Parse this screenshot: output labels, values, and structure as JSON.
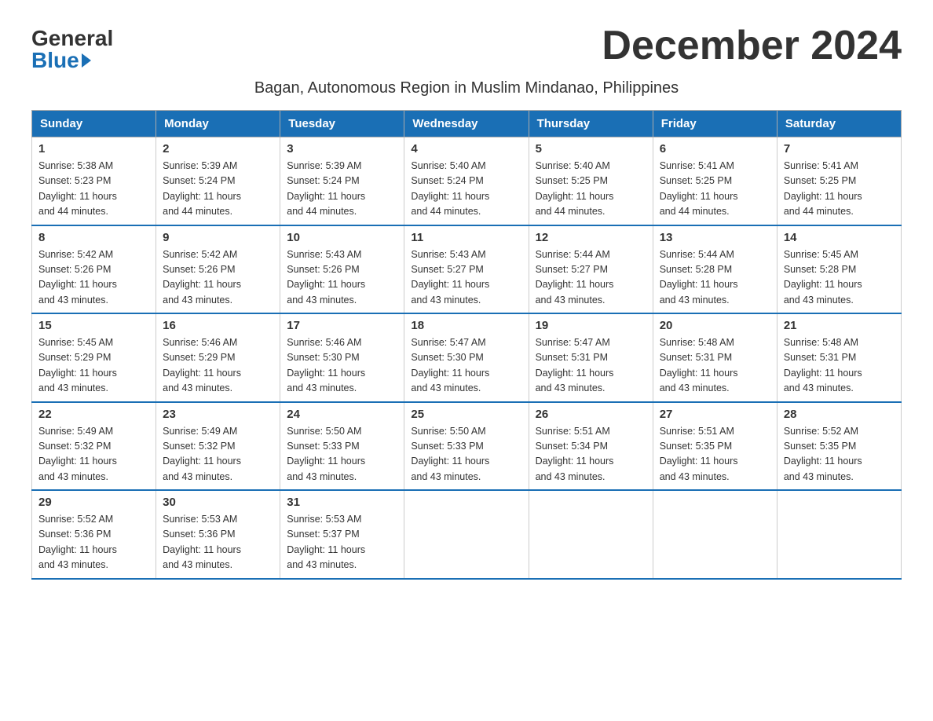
{
  "logo": {
    "general": "General",
    "blue": "Blue"
  },
  "title": "December 2024",
  "subtitle": "Bagan, Autonomous Region in Muslim Mindanao, Philippines",
  "days_of_week": [
    "Sunday",
    "Monday",
    "Tuesday",
    "Wednesday",
    "Thursday",
    "Friday",
    "Saturday"
  ],
  "weeks": [
    [
      {
        "day": "1",
        "sunrise": "5:38 AM",
        "sunset": "5:23 PM",
        "daylight": "11 hours and 44 minutes."
      },
      {
        "day": "2",
        "sunrise": "5:39 AM",
        "sunset": "5:24 PM",
        "daylight": "11 hours and 44 minutes."
      },
      {
        "day": "3",
        "sunrise": "5:39 AM",
        "sunset": "5:24 PM",
        "daylight": "11 hours and 44 minutes."
      },
      {
        "day": "4",
        "sunrise": "5:40 AM",
        "sunset": "5:24 PM",
        "daylight": "11 hours and 44 minutes."
      },
      {
        "day": "5",
        "sunrise": "5:40 AM",
        "sunset": "5:25 PM",
        "daylight": "11 hours and 44 minutes."
      },
      {
        "day": "6",
        "sunrise": "5:41 AM",
        "sunset": "5:25 PM",
        "daylight": "11 hours and 44 minutes."
      },
      {
        "day": "7",
        "sunrise": "5:41 AM",
        "sunset": "5:25 PM",
        "daylight": "11 hours and 44 minutes."
      }
    ],
    [
      {
        "day": "8",
        "sunrise": "5:42 AM",
        "sunset": "5:26 PM",
        "daylight": "11 hours and 43 minutes."
      },
      {
        "day": "9",
        "sunrise": "5:42 AM",
        "sunset": "5:26 PM",
        "daylight": "11 hours and 43 minutes."
      },
      {
        "day": "10",
        "sunrise": "5:43 AM",
        "sunset": "5:26 PM",
        "daylight": "11 hours and 43 minutes."
      },
      {
        "day": "11",
        "sunrise": "5:43 AM",
        "sunset": "5:27 PM",
        "daylight": "11 hours and 43 minutes."
      },
      {
        "day": "12",
        "sunrise": "5:44 AM",
        "sunset": "5:27 PM",
        "daylight": "11 hours and 43 minutes."
      },
      {
        "day": "13",
        "sunrise": "5:44 AM",
        "sunset": "5:28 PM",
        "daylight": "11 hours and 43 minutes."
      },
      {
        "day": "14",
        "sunrise": "5:45 AM",
        "sunset": "5:28 PM",
        "daylight": "11 hours and 43 minutes."
      }
    ],
    [
      {
        "day": "15",
        "sunrise": "5:45 AM",
        "sunset": "5:29 PM",
        "daylight": "11 hours and 43 minutes."
      },
      {
        "day": "16",
        "sunrise": "5:46 AM",
        "sunset": "5:29 PM",
        "daylight": "11 hours and 43 minutes."
      },
      {
        "day": "17",
        "sunrise": "5:46 AM",
        "sunset": "5:30 PM",
        "daylight": "11 hours and 43 minutes."
      },
      {
        "day": "18",
        "sunrise": "5:47 AM",
        "sunset": "5:30 PM",
        "daylight": "11 hours and 43 minutes."
      },
      {
        "day": "19",
        "sunrise": "5:47 AM",
        "sunset": "5:31 PM",
        "daylight": "11 hours and 43 minutes."
      },
      {
        "day": "20",
        "sunrise": "5:48 AM",
        "sunset": "5:31 PM",
        "daylight": "11 hours and 43 minutes."
      },
      {
        "day": "21",
        "sunrise": "5:48 AM",
        "sunset": "5:31 PM",
        "daylight": "11 hours and 43 minutes."
      }
    ],
    [
      {
        "day": "22",
        "sunrise": "5:49 AM",
        "sunset": "5:32 PM",
        "daylight": "11 hours and 43 minutes."
      },
      {
        "day": "23",
        "sunrise": "5:49 AM",
        "sunset": "5:32 PM",
        "daylight": "11 hours and 43 minutes."
      },
      {
        "day": "24",
        "sunrise": "5:50 AM",
        "sunset": "5:33 PM",
        "daylight": "11 hours and 43 minutes."
      },
      {
        "day": "25",
        "sunrise": "5:50 AM",
        "sunset": "5:33 PM",
        "daylight": "11 hours and 43 minutes."
      },
      {
        "day": "26",
        "sunrise": "5:51 AM",
        "sunset": "5:34 PM",
        "daylight": "11 hours and 43 minutes."
      },
      {
        "day": "27",
        "sunrise": "5:51 AM",
        "sunset": "5:35 PM",
        "daylight": "11 hours and 43 minutes."
      },
      {
        "day": "28",
        "sunrise": "5:52 AM",
        "sunset": "5:35 PM",
        "daylight": "11 hours and 43 minutes."
      }
    ],
    [
      {
        "day": "29",
        "sunrise": "5:52 AM",
        "sunset": "5:36 PM",
        "daylight": "11 hours and 43 minutes."
      },
      {
        "day": "30",
        "sunrise": "5:53 AM",
        "sunset": "5:36 PM",
        "daylight": "11 hours and 43 minutes."
      },
      {
        "day": "31",
        "sunrise": "5:53 AM",
        "sunset": "5:37 PM",
        "daylight": "11 hours and 43 minutes."
      },
      null,
      null,
      null,
      null
    ]
  ],
  "labels": {
    "sunrise": "Sunrise:",
    "sunset": "Sunset:",
    "daylight": "Daylight:"
  }
}
